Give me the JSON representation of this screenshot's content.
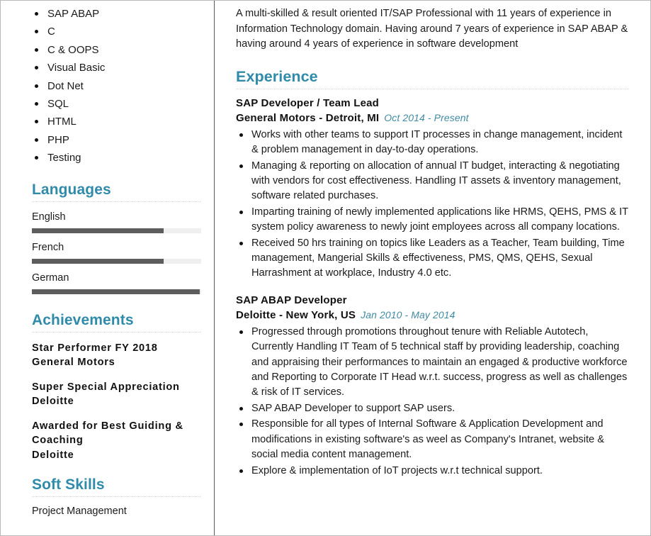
{
  "theme": {
    "accent": "#2f8ba9",
    "date_accent": "#3f8ba4",
    "text": "#1b1b1b",
    "bar_fill": "#5d5d5d",
    "bar_track": "#efefef",
    "divider": "#5a5a5a"
  },
  "sidebar": {
    "skills": [
      "SAP ABAP",
      "C",
      "C & OOPS",
      "Visual Basic",
      "Dot Net",
      "SQL",
      "HTML",
      "PHP",
      "Testing"
    ],
    "languages": {
      "heading": "Languages",
      "items": [
        {
          "name": "English",
          "level": 78
        },
        {
          "name": "French",
          "level": 78
        },
        {
          "name": "German",
          "level": 99
        }
      ]
    },
    "achievements": {
      "heading": "Achievements",
      "items": [
        {
          "title": "Star Performer FY 2018",
          "org": "General Motors"
        },
        {
          "title": "Super Special Appreciation",
          "org": "Deloitte"
        },
        {
          "title": "Awarded for Best Guiding & Coaching",
          "org": "Deloitte"
        }
      ]
    },
    "soft_skills": {
      "heading": "Soft Skills",
      "items": [
        "Project Management"
      ]
    }
  },
  "main": {
    "summary": "A multi-skilled & result oriented IT/SAP Professional with 11 years of experience in Information Technology domain. Having around 7 years of experience in SAP ABAP & having around 4 years of experience in software development",
    "experience": {
      "heading": "Experience",
      "jobs": [
        {
          "title": "SAP Developer / Team Lead",
          "company": "General Motors - Detroit, MI",
          "dates": "Oct 2014 - Present",
          "bullets": [
            "Works with other teams to support IT processes in change management, incident & problem management in day-to-day operations.",
            "Managing & reporting on allocation of annual IT budget, interacting & negotiating with vendors for cost effectiveness. Handling IT assets & inventory management, software related purchases.",
            "Imparting training of newly implemented applications like HRMS, QEHS, PMS & IT system policy awareness to newly joint employees across all company locations.",
            "Received 50 hrs training on topics like Leaders as a Teacher, Team building, Time management, Mangerial Skills & effectiveness, PMS, QMS, QEHS, Sexual Harrashment at workplace, Industry 4.0 etc."
          ]
        },
        {
          "title": "SAP ABAP Developer",
          "company": "Deloitte - New York, US",
          "dates": "Jan 2010 - May 2014",
          "bullets": [
            "Progressed through promotions throughout tenure with Reliable Autotech, Currently Handling IT Team of 5 technical staff by providing leadership, coaching and appraising their performances to maintain an engaged & productive workforce and Reporting to Corporate IT Head w.r.t. success, progress as well as challenges & risk of IT services.",
            "SAP ABAP Developer to support SAP users.",
            "Responsible for all types of Internal Software & Application Development and modifications in existing software's as weel as Company's Intranet, website & social media content management.",
            "Explore & implementation of IoT projects w.r.t technical support."
          ]
        }
      ]
    }
  }
}
